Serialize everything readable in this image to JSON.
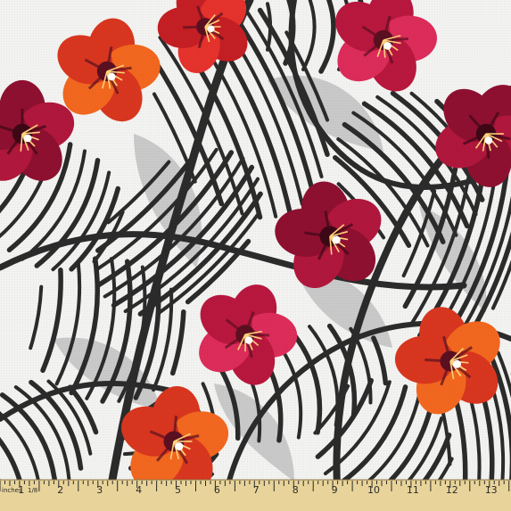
{
  "product": {
    "type": "fabric swatch",
    "pattern": "hibiscus flowers over zebra-striped leaves"
  },
  "colors": {
    "background": "#f2f2f0",
    "stripe": "#2b2b2b",
    "leaf_shadow": "#c9c9c9",
    "red": "#d9302c",
    "orange": "#f0661f",
    "crimson": "#a8163a",
    "pink": "#d22a55",
    "center": "#5a1020",
    "stamen": "#ffd27a"
  },
  "ruler": {
    "unit_label": "inches",
    "fraction_label": "1/8",
    "numbers": [
      "1",
      "2",
      "3",
      "4",
      "5",
      "6",
      "7",
      "8",
      "9",
      "10",
      "11",
      "12",
      "13"
    ]
  },
  "flowers": [
    {
      "name": "flower-top-left-orange",
      "palette": "orange"
    },
    {
      "name": "flower-top-center-red",
      "palette": "red"
    },
    {
      "name": "flower-top-right-pink",
      "palette": "pink"
    },
    {
      "name": "flower-left-crimson",
      "palette": "crimson"
    },
    {
      "name": "flower-right-crimson",
      "palette": "crimson"
    },
    {
      "name": "flower-center-crimson",
      "palette": "crimson"
    },
    {
      "name": "flower-mid-left-red",
      "palette": "pink"
    },
    {
      "name": "flower-mid-right-orange",
      "palette": "orange"
    },
    {
      "name": "flower-bottom-left-orange",
      "palette": "orange"
    }
  ]
}
